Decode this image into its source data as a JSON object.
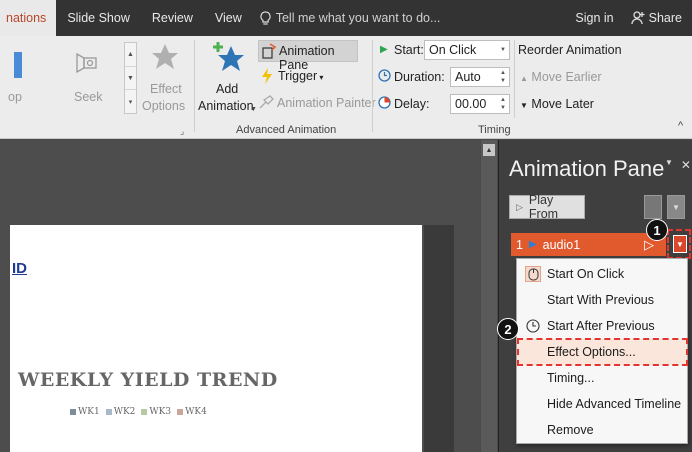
{
  "tabs": {
    "animations": "nations",
    "slideshow": "Slide Show",
    "review": "Review",
    "view": "View",
    "tellme": "Tell me what you want to do...",
    "signin": "Sign in",
    "share": "Share"
  },
  "ribbon": {
    "partial_label": "op",
    "seek": "Seek",
    "effect_options_1": "Effect",
    "effect_options_2": "Options",
    "add_animation_1": "Add",
    "add_animation_2": "Animation",
    "animation_pane": "Animation Pane",
    "trigger": "Trigger",
    "animation_painter": "Animation Painter",
    "advanced_group": "Advanced Animation",
    "start_label": "Start:",
    "start_value": "On Click",
    "duration_label": "Duration:",
    "duration_value": "Auto",
    "delay_label": "Delay:",
    "delay_value": "00.00",
    "timing_group": "Timing",
    "reorder": "Reorder Animation",
    "move_earlier": "Move Earlier",
    "move_later": "Move Later"
  },
  "slide": {
    "id_text": "ID",
    "chart_title": "WEEKLY YIELD TREND",
    "legend": [
      "WK1",
      "WK2",
      "WK3",
      "WK4"
    ]
  },
  "colors": {
    "accent": "#b7472a",
    "item": "#e05a2e",
    "highlight": "#e3342f",
    "legend": [
      "#7f8c9b",
      "#a9b8c9",
      "#b8c7a5",
      "#c9a89a"
    ]
  },
  "pane": {
    "title": "Animation Pane",
    "play_from": "Play From",
    "item_number": "1",
    "item_name": "audio1"
  },
  "menu": {
    "items": [
      "Start On Click",
      "Start With Previous",
      "Start After Previous",
      "Effect Options...",
      "Timing...",
      "Hide Advanced Timeline",
      "Remove"
    ],
    "icons": [
      "mouse-click-icon",
      "",
      "clock-icon",
      "",
      "",
      "",
      ""
    ]
  },
  "callouts": [
    "1",
    "2"
  ]
}
